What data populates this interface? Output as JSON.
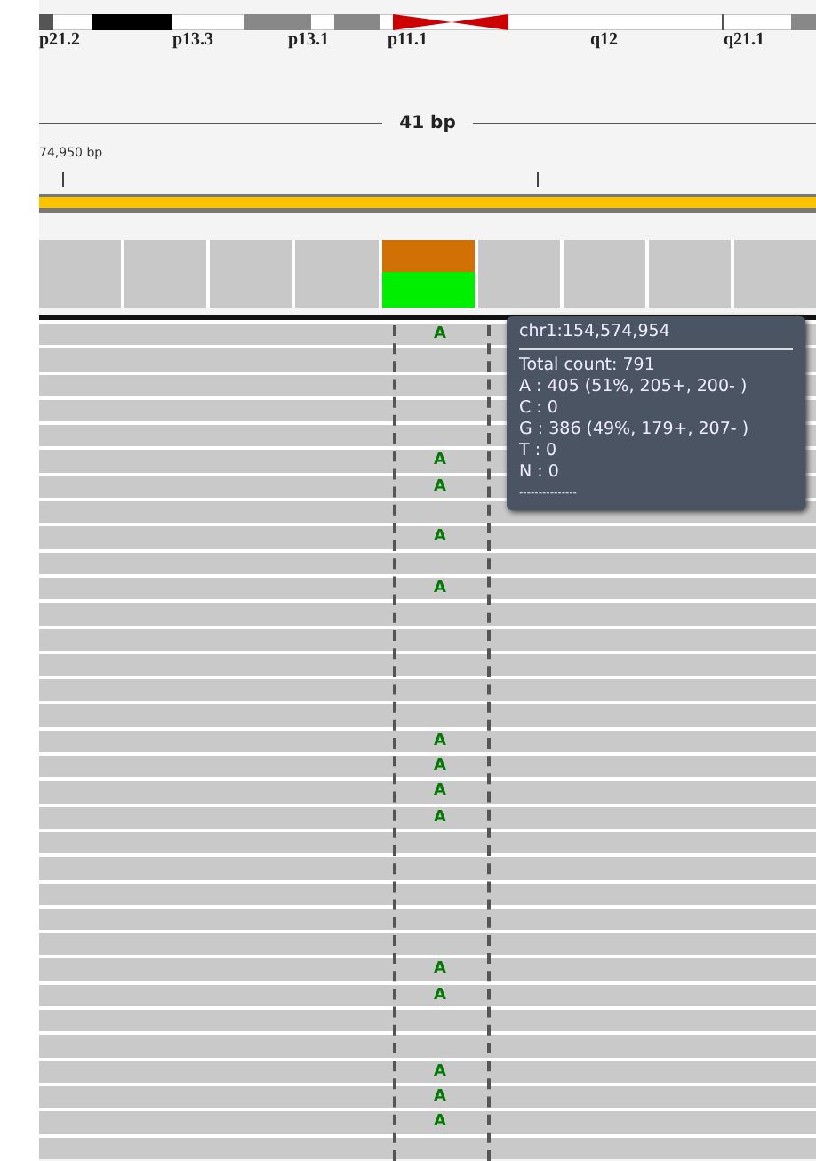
{
  "ideogram": {
    "bands": [
      "p21.2",
      "p13.3",
      "p13.1",
      "p11.1",
      "q12",
      "q21.1"
    ]
  },
  "ruler": {
    "span": "41 bp",
    "start": "74,950 bp"
  },
  "coverage": {
    "columns": [
      {
        "kind": "plain"
      },
      {
        "kind": "plain"
      },
      {
        "kind": "plain"
      },
      {
        "kind": "plain"
      },
      {
        "kind": "mixed"
      },
      {
        "kind": "plain"
      },
      {
        "kind": "plain"
      },
      {
        "kind": "plain"
      },
      {
        "kind": "plain"
      }
    ]
  },
  "reads": [
    {
      "kind": "mismatch",
      "base": "A"
    },
    {
      "kind": "match"
    },
    {
      "kind": "match"
    },
    {
      "kind": "match"
    },
    {
      "kind": "match"
    },
    {
      "kind": "mismatch",
      "base": "A"
    },
    {
      "kind": "mismatch",
      "base": "A"
    },
    {
      "kind": "match"
    },
    {
      "kind": "mismatch",
      "base": "A"
    },
    {
      "kind": "match"
    },
    {
      "kind": "mismatch",
      "base": "A"
    },
    {
      "kind": "match"
    },
    {
      "kind": "match"
    },
    {
      "kind": "match"
    },
    {
      "kind": "match"
    },
    {
      "kind": "match"
    },
    {
      "kind": "mismatch",
      "base": "A"
    },
    {
      "kind": "mismatch",
      "base": "A"
    },
    {
      "kind": "mismatch",
      "base": "A"
    },
    {
      "kind": "mismatch",
      "base": "A"
    },
    {
      "kind": "match"
    },
    {
      "kind": "match"
    },
    {
      "kind": "match"
    },
    {
      "kind": "match"
    },
    {
      "kind": "match"
    },
    {
      "kind": "mismatch",
      "base": "A"
    },
    {
      "kind": "mismatch",
      "base": "A"
    },
    {
      "kind": "match"
    },
    {
      "kind": "match"
    },
    {
      "kind": "mismatch",
      "base": "A"
    },
    {
      "kind": "mismatch",
      "base": "A"
    },
    {
      "kind": "mismatch",
      "base": "A"
    },
    {
      "kind": "match"
    }
  ],
  "tooltip": {
    "title": "chr1:154,574,954",
    "lines": [
      "Total count: 791",
      "A : 405 (51%, 205+, 200- )",
      "C : 0",
      "G : 386 (49%, 179+, 207- )",
      "T : 0",
      "N : 0"
    ],
    "footer": "---------------"
  }
}
